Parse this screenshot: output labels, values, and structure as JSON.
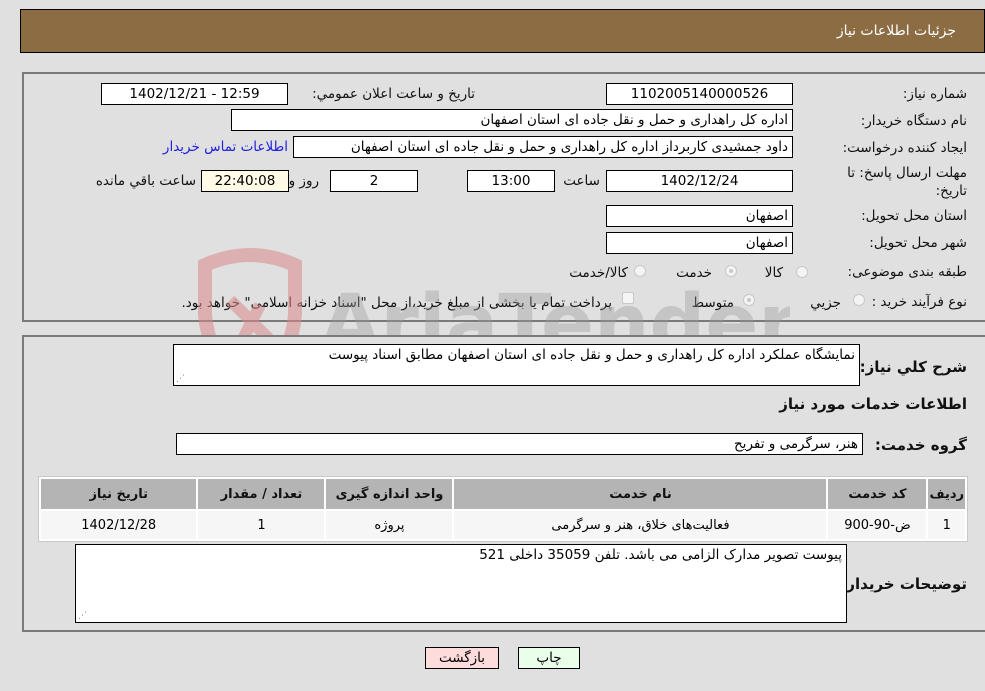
{
  "header": {
    "title": "جزئيات اطلاعات نياز"
  },
  "form": {
    "need_number_label": "شماره نیاز:",
    "need_number": "1102005140000526",
    "announce_label": "تاريخ و ساعت اعلان عمومي:",
    "announce_value": "1402/12/21 - 12:59",
    "buyer_org_label": "نام دستگاه خریدار:",
    "buyer_org": "اداره کل راهداری و حمل و نقل جاده ای استان اصفهان",
    "creator_label": "ایجاد کننده درخواست:",
    "creator": "داود جمشیدی کاربرداز اداره کل راهداری و حمل و نقل جاده ای استان اصفهان",
    "contact_link": "اطلاعات تماس خریدار",
    "deadline_label": "مهلت ارسال پاسخ: تا تاریخ:",
    "deadline_date": "1402/12/24",
    "time_label": "ساعت",
    "deadline_time": "13:00",
    "days_value": "2",
    "days_label": "روز و",
    "remaining_time": "22:40:08",
    "remaining_label": "ساعت باقي مانده",
    "province_label": "استان محل تحویل:",
    "province": "اصفهان",
    "city_label": "شهر محل تحویل:",
    "city": "اصفهان",
    "category_label": "طبقه بندی موضوعی:",
    "category_options": [
      {
        "label": "کالا",
        "checked": false
      },
      {
        "label": "خدمت",
        "checked": true
      },
      {
        "label": "کالا/خدمت",
        "checked": false
      }
    ],
    "process_label": "نوع فرآیند خرید :",
    "process_options": [
      {
        "label": "جزيي",
        "checked": false
      },
      {
        "label": "متوسط",
        "checked": true
      }
    ],
    "treasury_note": "پرداخت تمام یا بخشی از مبلغ خرید،از محل \"اسناد خزانه اسلامی\" خواهد بود.",
    "treasury_checked": false
  },
  "details": {
    "summary_label": "شرح کلي نياز:",
    "summary": "نمایشگاه عملکرد اداره کل راهداری و حمل و نقل جاده ای استان اصفهان مطابق اسناد پیوست",
    "services_heading": "اطلاعات خدمات مورد نياز",
    "service_group_label": "گروه خدمت:",
    "service_group": "هنر، سرگرمی و تفریح",
    "table": {
      "headers": [
        "رديف",
        "کد خدمت",
        "نام خدمت",
        "واحد اندازه گیری",
        "تعداد / مقدار",
        "تاریخ نیاز"
      ],
      "rows": [
        [
          "1",
          "ض-90-900",
          "فعالیت‌های خلاق، هنر و سرگرمی",
          "پروژه",
          "1",
          "1402/12/28"
        ]
      ]
    },
    "buyer_notes_label": "توضیحات خریدار:",
    "buyer_notes": "پیوست تصویر مدارک الزامی می باشد. تلفن 35059 داخلی 521"
  },
  "buttons": {
    "print": "چاپ",
    "back": "بازگشت"
  },
  "watermark": {
    "text": "AriaTender.neT",
    "color": "#d98a8a"
  }
}
